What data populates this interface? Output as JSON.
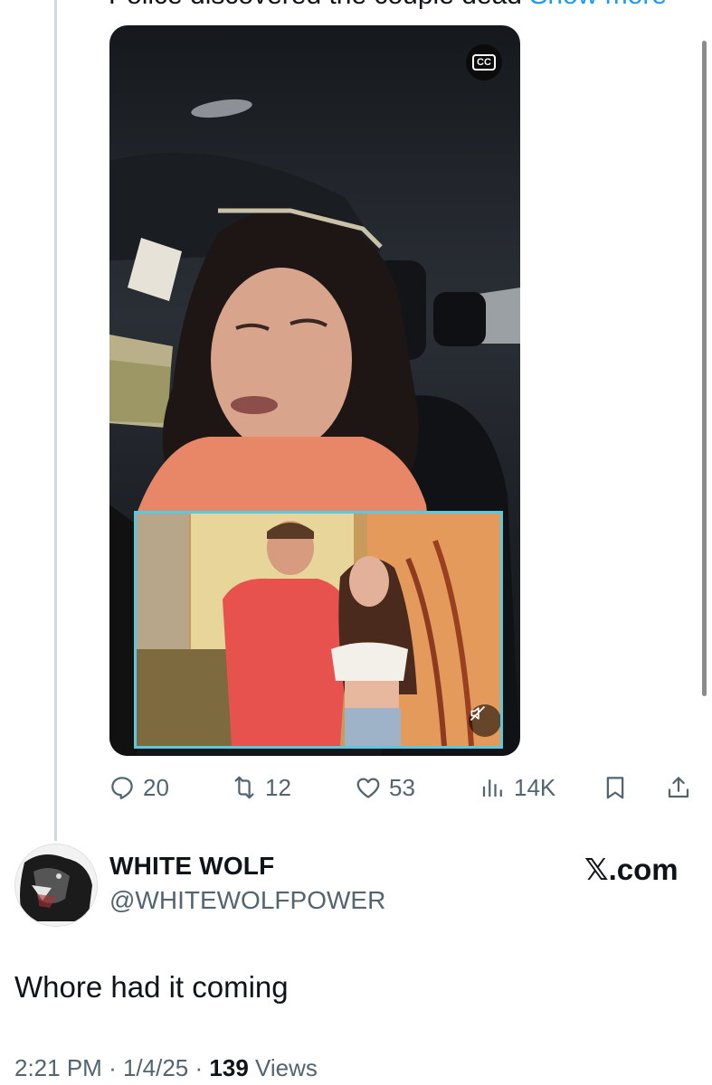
{
  "previous_tweet": {
    "truncated_text": "Police discovered the couple dead",
    "show_more_label": "Show more",
    "video": {
      "captions_button": "CC"
    },
    "actions": {
      "replies": "20",
      "reposts": "12",
      "likes": "53",
      "views": "14K"
    }
  },
  "reply": {
    "display_name": "WHITE WOLF",
    "handle": "@WHITEWOLFPOWER",
    "watermark": "𝕏.com",
    "text": "Whore had it coming",
    "time": "2:21 PM",
    "date": "1/4/25",
    "views_count": "139",
    "views_label": "Views",
    "separator": "·"
  },
  "colors": {
    "text": "#0f1419",
    "secondary": "#536471",
    "link": "#1d9bf0",
    "pip_border": "#5ac8df"
  }
}
